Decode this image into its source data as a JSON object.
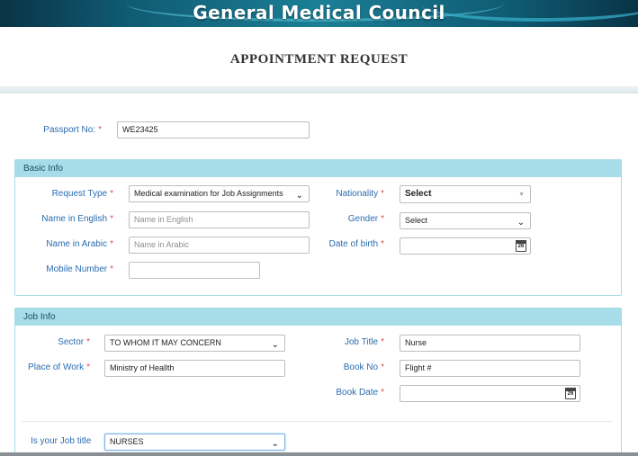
{
  "header": {
    "org_name": "General Medical Council",
    "page_title": "APPOINTMENT REQUEST"
  },
  "passport": {
    "label": "Passport No:",
    "value": "WE23425"
  },
  "basic_info": {
    "section_title": "Basic Info",
    "request_type": {
      "label": "Request Type",
      "value": "Medical examination for Job Assignments"
    },
    "nationality": {
      "label": "Nationality",
      "value": "Select"
    },
    "name_en": {
      "label": "Name in English",
      "placeholder": "Name in English"
    },
    "gender": {
      "label": "Gender",
      "value": "Select"
    },
    "name_ar": {
      "label": "Name in Arabic",
      "placeholder": "Name in Arabic"
    },
    "dob": {
      "label": "Date of birth",
      "value": "",
      "calendar_day": "26"
    },
    "mobile": {
      "label": "Mobile Number",
      "value": ""
    }
  },
  "job_info": {
    "section_title": "Job Info",
    "sector": {
      "label": "Sector",
      "value": "TO WHOM IT MAY CONCERN"
    },
    "job_title": {
      "label": "Job Title",
      "value": "Nurse"
    },
    "place_of_work": {
      "label": "Place of Work",
      "value": "Ministry of Heallth"
    },
    "book_no": {
      "label": "Book No",
      "value": "Flight #"
    },
    "book_date": {
      "label": "Book Date",
      "value": "",
      "calendar_day": "26"
    },
    "job_title_medical": {
      "label": "Is your Job title",
      "value": "NURSES"
    }
  },
  "required_marker": "*",
  "icons": {
    "dropdown": "chevron-down-icon",
    "calendar": "calendar-icon"
  },
  "colors": {
    "label": "#2b6cb0",
    "required": "#d9534f",
    "panel_header": "#a6dde8",
    "banner": "#0f5b73"
  }
}
